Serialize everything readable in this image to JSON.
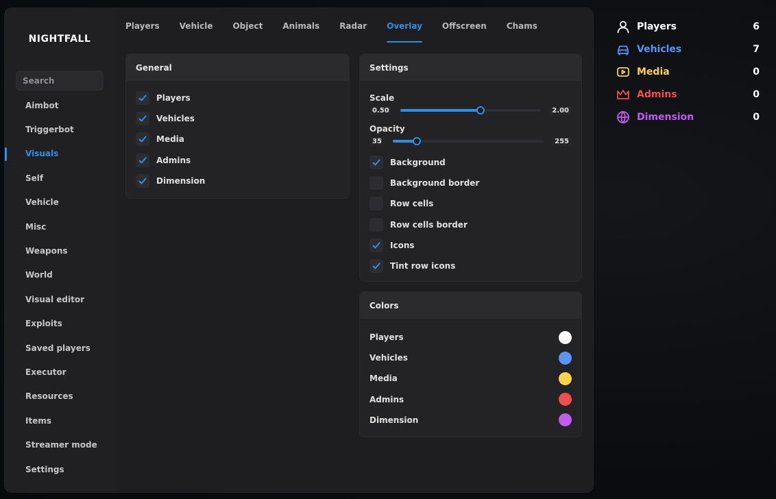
{
  "app": {
    "title": "NIGHTFALL"
  },
  "search": {
    "placeholder": "Search"
  },
  "sidebar": {
    "items": [
      {
        "label": "Aimbot"
      },
      {
        "label": "Triggerbot"
      },
      {
        "label": "Visuals",
        "active": true
      },
      {
        "label": "Self"
      },
      {
        "label": "Vehicle"
      },
      {
        "label": "Misc"
      },
      {
        "label": "Weapons"
      },
      {
        "label": "World"
      },
      {
        "label": "Visual editor"
      },
      {
        "label": "Exploits"
      },
      {
        "label": "Saved players"
      },
      {
        "label": "Executor"
      },
      {
        "label": "Resources"
      },
      {
        "label": "Items"
      },
      {
        "label": "Streamer mode"
      },
      {
        "label": "Settings"
      }
    ]
  },
  "tabs": [
    {
      "label": "Players"
    },
    {
      "label": "Vehicle"
    },
    {
      "label": "Object"
    },
    {
      "label": "Animals"
    },
    {
      "label": "Radar"
    },
    {
      "label": "Overlay",
      "active": true
    },
    {
      "label": "Offscreen"
    },
    {
      "label": "Chams"
    }
  ],
  "general": {
    "title": "General",
    "options": [
      {
        "label": "Players",
        "checked": true
      },
      {
        "label": "Vehicles",
        "checked": true
      },
      {
        "label": "Media",
        "checked": true
      },
      {
        "label": "Admins",
        "checked": true
      },
      {
        "label": "Dimension",
        "checked": true
      }
    ]
  },
  "settings": {
    "title": "Settings",
    "scale": {
      "label": "Scale",
      "min": "0.50",
      "max": "2.00",
      "fraction": 0.57
    },
    "opacity": {
      "label": "Opacity",
      "min": "35",
      "max": "255",
      "fraction": 0.16
    },
    "options": [
      {
        "label": "Background",
        "checked": true
      },
      {
        "label": "Background border",
        "checked": false
      },
      {
        "label": "Row cells",
        "checked": false
      },
      {
        "label": "Row cells border",
        "checked": false
      },
      {
        "label": "Icons",
        "checked": true
      },
      {
        "label": "Tint row icons",
        "checked": true
      }
    ]
  },
  "colors": {
    "title": "Colors",
    "items": [
      {
        "label": "Players",
        "color": "#ffffff"
      },
      {
        "label": "Vehicles",
        "color": "#5b95f5"
      },
      {
        "label": "Media",
        "color": "#fcd34d"
      },
      {
        "label": "Admins",
        "color": "#ef4f4f"
      },
      {
        "label": "Dimension",
        "color": "#c25cf0"
      }
    ]
  },
  "overlay": {
    "rows": [
      {
        "label": "Players",
        "count": "6",
        "color": "#ffffff",
        "icon": "user-icon"
      },
      {
        "label": "Vehicles",
        "count": "7",
        "color": "#5b95f5",
        "icon": "car-icon"
      },
      {
        "label": "Media",
        "count": "0",
        "color": "#fcd34d",
        "icon": "play-icon"
      },
      {
        "label": "Admins",
        "count": "0",
        "color": "#ef4f4f",
        "icon": "crown-icon"
      },
      {
        "label": "Dimension",
        "count": "0",
        "color": "#c25cf0",
        "icon": "globe-icon"
      }
    ]
  },
  "accent": "#2e8fe6"
}
